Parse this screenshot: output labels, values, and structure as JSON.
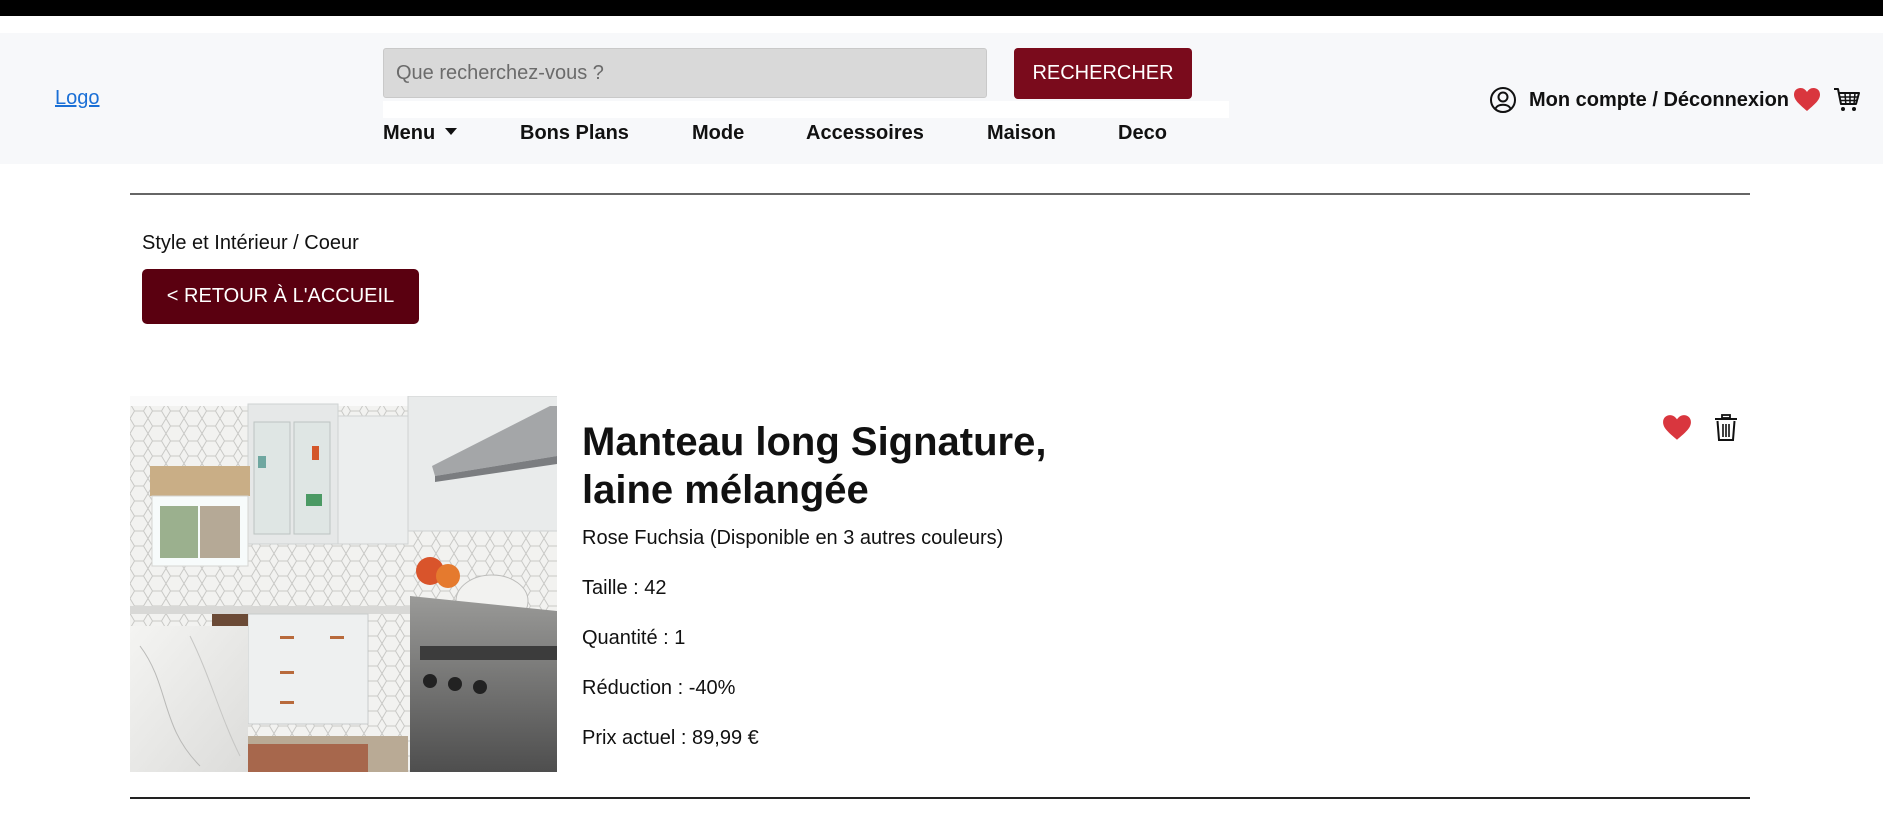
{
  "header": {
    "logo": "Logo",
    "search": {
      "placeholder": "Que recherchez-vous ?",
      "value": "",
      "button": "RECHERCHER"
    },
    "nav": [
      "Menu",
      "Bons Plans",
      "Mode",
      "Accessoires",
      "Maison",
      "Deco"
    ],
    "account": "Mon compte / Déconnexion"
  },
  "breadcrumb": "Style et Intérieur / Coeur",
  "back_button": "< RETOUR À L'ACCUEIL",
  "product": {
    "title": "Manteau long Signature, laine mélangée",
    "color": "Rose Fuchsia (Disponible en 3 autres couleurs)",
    "size": "Taille : 42",
    "quantity": "Quantité : 1",
    "discount": "Réduction : -40%",
    "price": "Prix actuel : 89,99 €"
  },
  "icons": {
    "account": "user-circle-icon",
    "wishlist": "heart-icon",
    "cart": "cart-icon",
    "remove": "trash-icon"
  },
  "colors": {
    "brand": "#7a0b1c",
    "back_button": "#5a0010",
    "heart": "#d9363e",
    "link": "#1a6fd6"
  }
}
